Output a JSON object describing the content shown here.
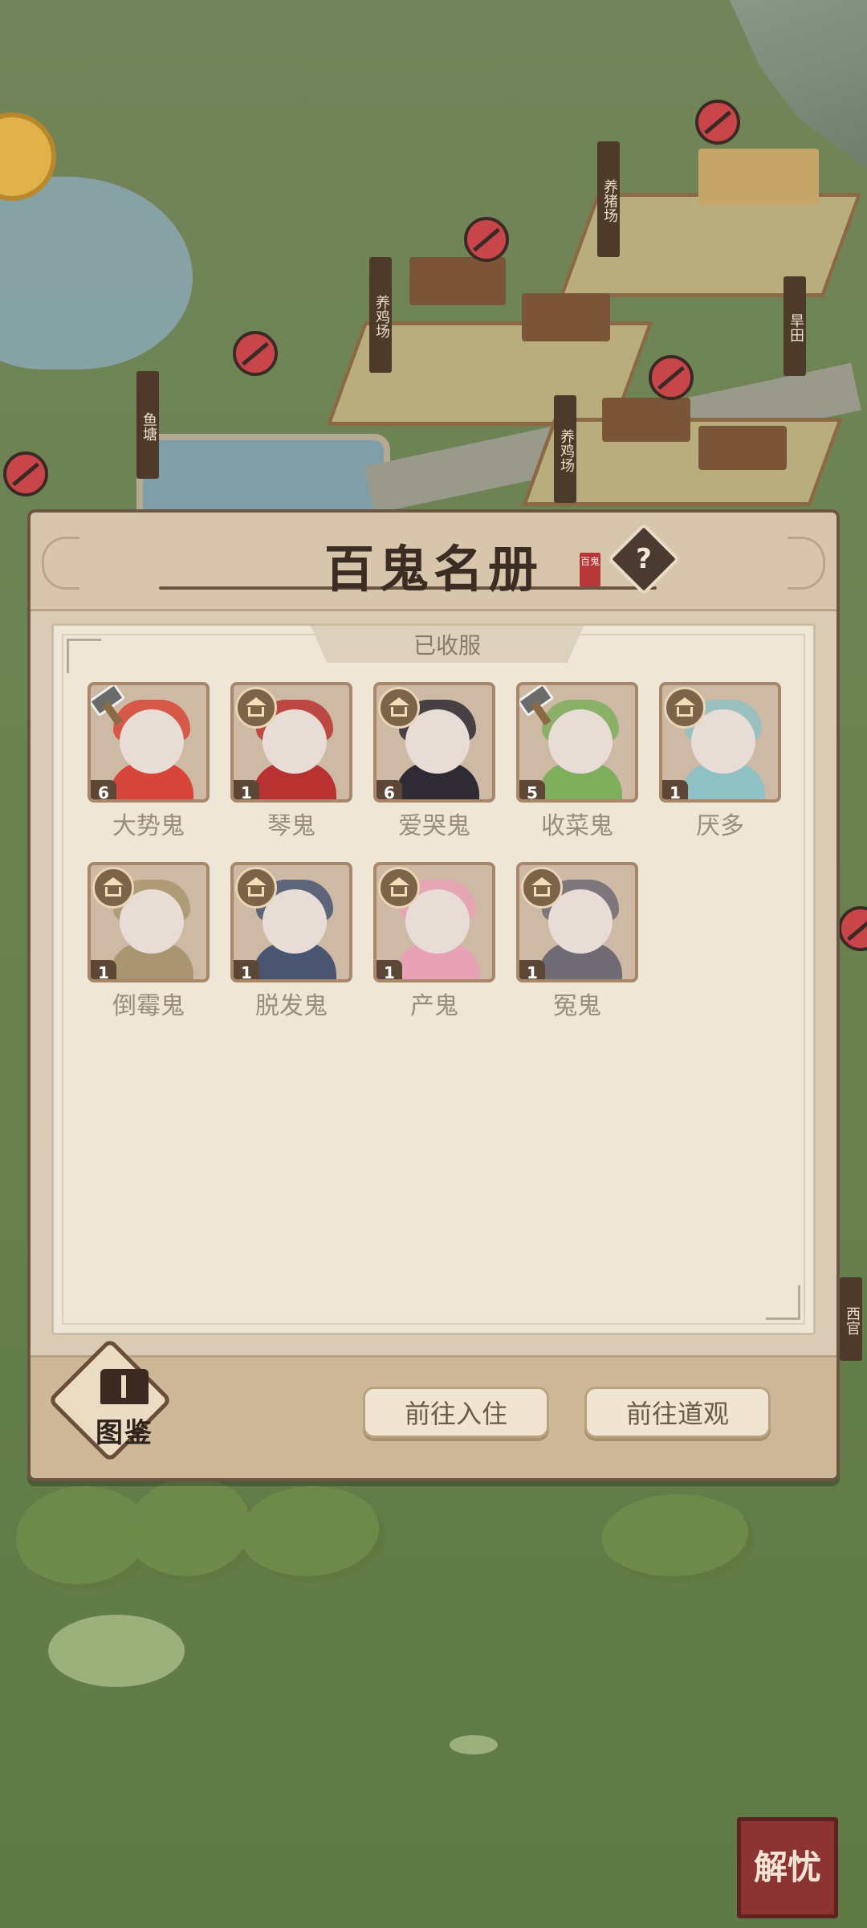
{
  "map": {
    "signs": [
      "养猪场",
      "养鸡场",
      "鱼塘",
      "养鸡场",
      "旱田",
      "西官"
    ]
  },
  "modal": {
    "title": "百鬼名册",
    "title_seal": "百鬼",
    "help_symbol": "?",
    "section_label": "已收服",
    "ghosts": [
      {
        "name": "大势鬼",
        "level": "6",
        "badge": "hammer",
        "palette": "#d6463a"
      },
      {
        "name": "琴鬼",
        "level": "1",
        "badge": "house",
        "palette": "#b93232"
      },
      {
        "name": "爱哭鬼",
        "level": "6",
        "badge": "house",
        "palette": "#2f2b35"
      },
      {
        "name": "收菜鬼",
        "level": "5",
        "badge": "hammer",
        "palette": "#7fae5d"
      },
      {
        "name": "厌多",
        "level": "1",
        "badge": "house",
        "palette": "#8fc0c4"
      },
      {
        "name": "倒霉鬼",
        "level": "1",
        "badge": "house",
        "palette": "#a99670"
      },
      {
        "name": "脱发鬼",
        "level": "1",
        "badge": "house",
        "palette": "#4a5572"
      },
      {
        "name": "产鬼",
        "level": "1",
        "badge": "house",
        "palette": "#e7a2b5"
      },
      {
        "name": "冤鬼",
        "level": "1",
        "badge": "house",
        "palette": "#6f6a73"
      }
    ],
    "atlas_label": "图鉴",
    "move_in_button": "前往入住",
    "temple_button": "前往道观"
  },
  "corner_button": "解忧",
  "colors": {
    "panel": "#eee7d8",
    "frame": "#6b5542",
    "accent_red": "#b8373a"
  }
}
